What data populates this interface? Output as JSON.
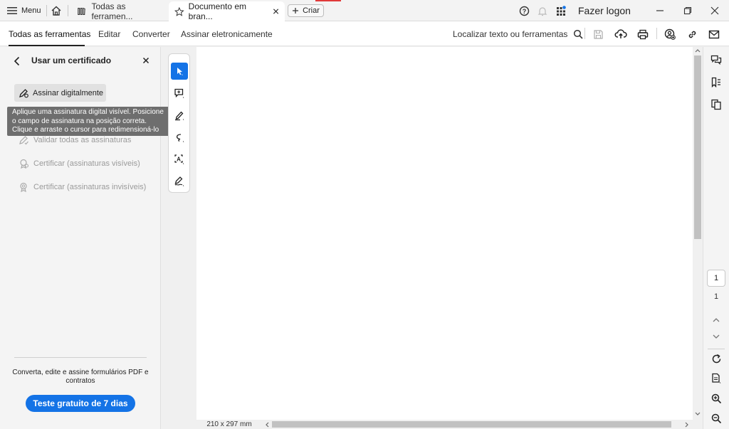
{
  "titlebar": {
    "menu_label": "Menu",
    "tabs": [
      {
        "label": "Todas as ferramen..."
      },
      {
        "label": "Documento em bran..."
      }
    ],
    "create_label": "Criar",
    "login_label": "Fazer logon"
  },
  "menubar": {
    "items": [
      "Todas as ferramentas",
      "Editar",
      "Converter",
      "Assinar eletronicamente"
    ],
    "search_label": "Localizar texto ou ferramentas"
  },
  "leftpanel": {
    "title": "Usar um certificado",
    "sign_button": "Assinar digitalmente",
    "items": [
      "Validar todas as assinaturas",
      "Certificar (assinaturas visíveis)",
      "Certificar (assinaturas invisíveis)"
    ],
    "promo_text": "Converta, edite e assine formulários PDF e contratos",
    "trial_button": "Teste gratuito de 7 dias"
  },
  "tooltip": {
    "text": "Aplique uma assinatura digital visível. Posicione o campo de assinatura na posição correta. Clique e arraste o cursor para redimensioná-lo"
  },
  "status": {
    "page_size": "210 x 297 mm",
    "page_current": "1",
    "page_total": "1"
  },
  "colors": {
    "accent": "#1473e6",
    "notification_dot": "#1473e6"
  }
}
